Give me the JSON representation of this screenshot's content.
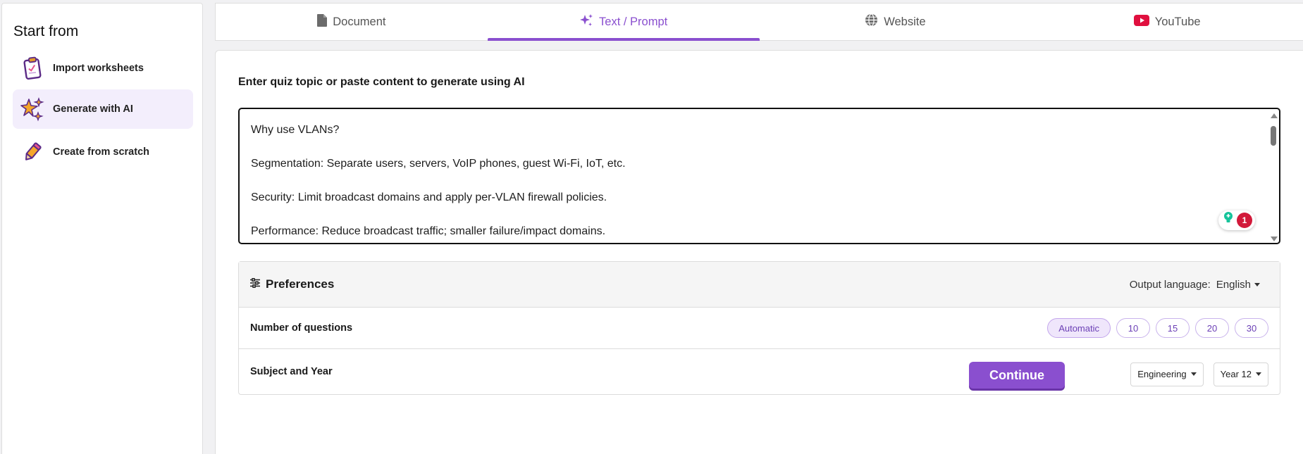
{
  "sidebar": {
    "title": "Start from",
    "items": [
      {
        "label": "Import worksheets",
        "icon": "clipboard-icon"
      },
      {
        "label": "Generate with AI",
        "icon": "sparkle-stars-icon",
        "active": true
      },
      {
        "label": "Create from scratch",
        "icon": "pencil-icon"
      }
    ]
  },
  "tabs": [
    {
      "label": "Document",
      "icon": "document-icon"
    },
    {
      "label": "Text / Prompt",
      "icon": "sparkle-icon",
      "active": true
    },
    {
      "label": "Website",
      "icon": "globe-icon"
    },
    {
      "label": "YouTube",
      "icon": "youtube-icon"
    }
  ],
  "main": {
    "prompt_label": "Enter quiz topic or paste content to generate using AI",
    "prompt_lines": [
      "Why use VLANs?",
      "Segmentation: Separate users, servers, VoIP phones, guest Wi-Fi, IoT, etc.",
      "Security: Limit broadcast domains and apply per-VLAN firewall policies.",
      "Performance: Reduce broadcast traffic; smaller failure/impact domains."
    ],
    "grammar_count": "1"
  },
  "preferences": {
    "title": "Preferences",
    "output_language_label": "Output language:",
    "output_language_value": "English",
    "num_questions_label": "Number of questions",
    "num_questions_options": [
      "Automatic",
      "10",
      "15",
      "20",
      "30"
    ],
    "num_questions_selected": "Automatic",
    "subject_year_label": "Subject and Year",
    "subject_value": "Engineering",
    "year_value": "Year 12"
  },
  "continue_label": "Continue",
  "colors": {
    "accent": "#8a4fcf",
    "active_bg": "#f3eefc",
    "youtube": "#e0103f",
    "grammar_badge": "#d2193a"
  }
}
